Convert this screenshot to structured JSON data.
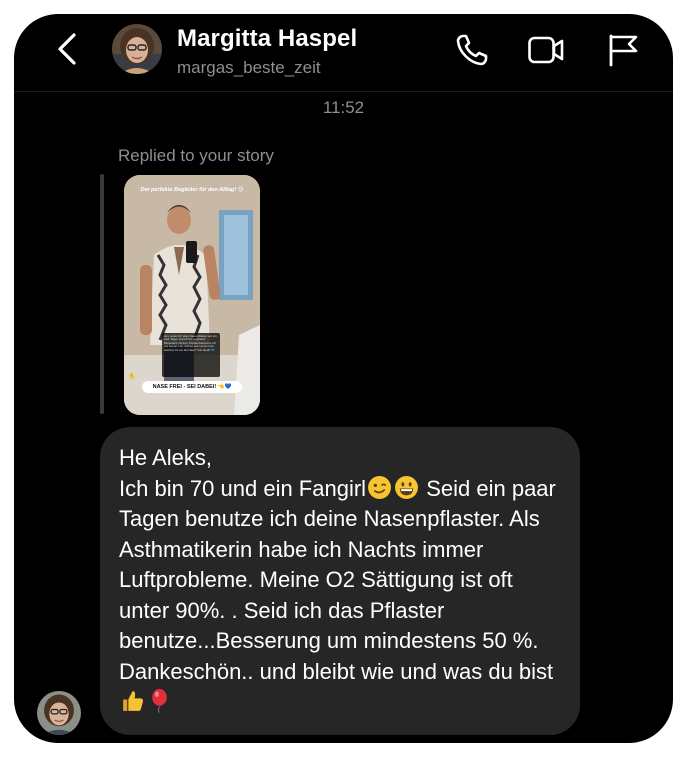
{
  "header": {
    "name": "Margitta Haspel",
    "handle": "margas_beste_zeit",
    "back_icon": "chevron-left-icon",
    "call_icon": "phone-icon",
    "video_icon": "video-camera-icon",
    "report_icon": "flag-icon"
  },
  "thread": {
    "timestamp": "11:52",
    "reply_label": "Replied to your story",
    "story": {
      "caption": "Der perfekte Begleiter für den Alltag! 😊",
      "textbox": "Hey Leute! Ich teste Nasenpflaster seit ein paar Tagen und ich bin begeistert. Besonders mit dem Produkt bekomme ich viel besser Luft. Schaut auf meinen Link, welches ist von der Nase? Viel Spaß! 💙",
      "sticker": "NASE FREI - SEI DABEI! 👈💙"
    },
    "message": {
      "line1": "He Aleks,",
      "line2a": "Ich bin 70 und ein Fangirl",
      "line2b": "Seid ein",
      "rest": "paar Tagen benutze ich deine Nasenpflaster. Als Asthmatikerin habe ich Nachts immer Luftprobleme. Meine O2 Sättigung ist oft unter 90%. . Seid ich das Pflaster benutze...Besserung um mindestens 50 %. Dankeschön.. und bleibt wie und was du bist"
    }
  },
  "colors": {
    "background": "#000000",
    "bubble": "#262626",
    "secondary_text": "#8e8e93",
    "primary_text": "#ffffff"
  }
}
